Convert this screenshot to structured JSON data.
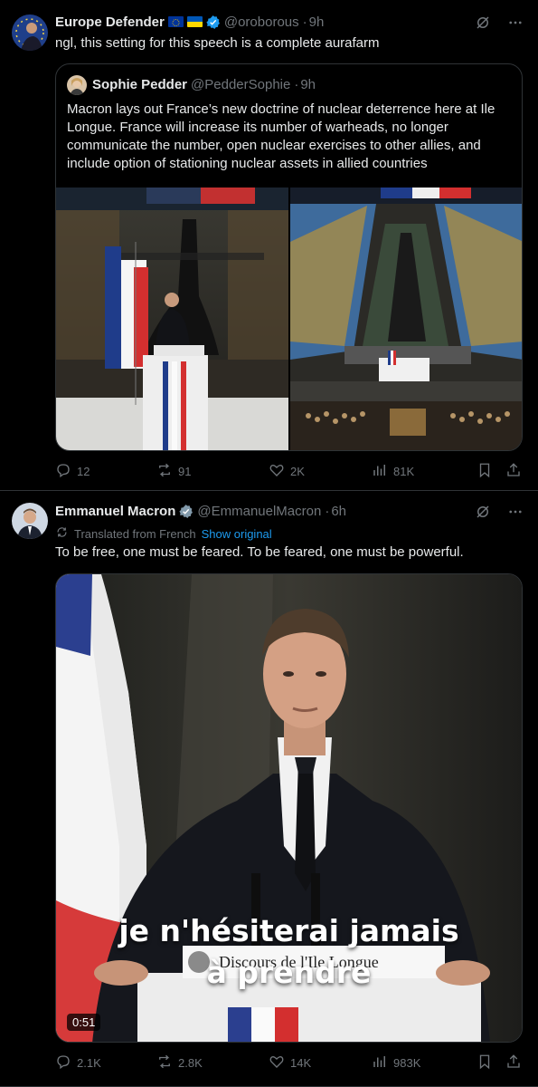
{
  "tweet1": {
    "author_name": "Europe Defender",
    "handle": "@oroborous",
    "time": "9h",
    "text": "ngl, this setting for this speech is a complete aurafarm",
    "quote": {
      "author_name": "Sophie Pedder",
      "handle": "@PedderSophie",
      "time": "9h",
      "text": "Macron lays out France’s new doctrine of nuclear deterrence here at Ile Longue. France will increase its number of warheads, no longer communicate the number, open nuclear exercises to other allies, and include option of  stationing nuclear assets in allied countries"
    },
    "actions": {
      "replies": "12",
      "reposts": "91",
      "likes": "2K",
      "views": "81K"
    }
  },
  "tweet2": {
    "author_name": "Emmanuel Macron",
    "handle": "@EmmanuelMacron",
    "time": "6h",
    "translated_label": "Translated from French",
    "show_original": "Show original",
    "text": "To be free, one must be feared. To be feared, one must be powerful.",
    "video": {
      "caption_line1": "je n'hésiterai jamais",
      "caption_line2": "à prendre",
      "lectern_sign": "Discours de l'Ile Longue",
      "duration": "0:51"
    },
    "actions": {
      "replies": "2.1K",
      "reposts": "2.8K",
      "likes": "14K",
      "views": "983K"
    }
  },
  "icons": [
    "grok-icon",
    "more-icon",
    "reply-icon",
    "repost-icon",
    "like-icon",
    "views-icon",
    "bookmark-icon",
    "share-icon"
  ],
  "colors": {
    "background": "#000000",
    "text": "#e7e9ea",
    "muted": "#71767b",
    "accent": "#1d9bf0",
    "border": "#2f3336"
  }
}
